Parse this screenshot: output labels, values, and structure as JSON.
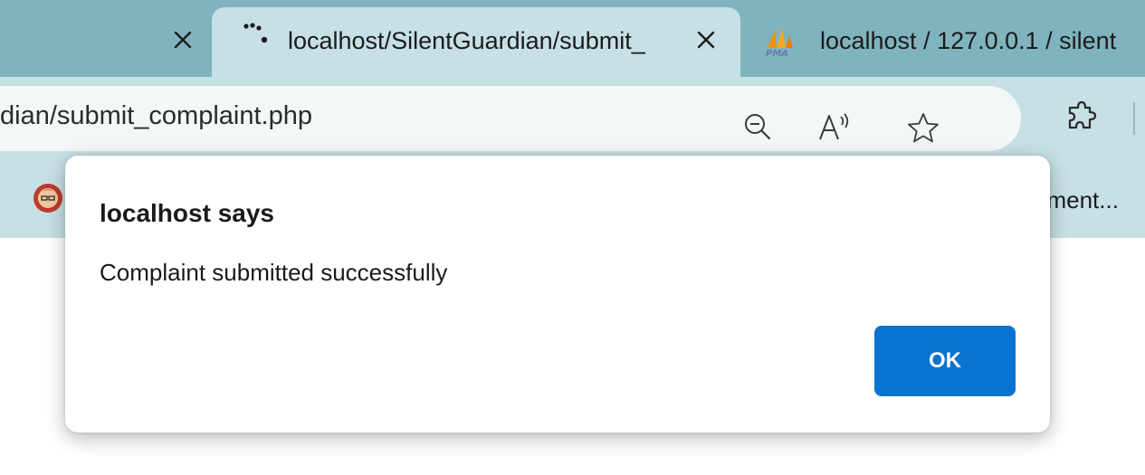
{
  "tabs": [
    {
      "title": "",
      "active": false,
      "close_label": "×"
    },
    {
      "title": "localhost/SilentGuardian/submit_",
      "active": true,
      "close_label": "×"
    },
    {
      "title": "localhost / 127.0.0.1 / silent",
      "active": false,
      "icon_text": "PMA"
    }
  ],
  "address_bar": {
    "url": "dian/submit_complaint.php"
  },
  "favorites_bar": {
    "right_item": "ement..."
  },
  "dialog": {
    "title": "localhost says",
    "message": "Complaint submitted successfully",
    "ok_label": "OK"
  },
  "colors": {
    "tabstrip": "#7fb4be",
    "toolbar": "#c7e0e5",
    "omnibox": "#f4f7f8",
    "ok_button": "#0a73d0"
  },
  "icons": [
    "close-icon",
    "loading-dots-icon",
    "pma-icon",
    "zoom-out-icon",
    "read-aloud-icon",
    "favorite-star-icon",
    "extensions-icon",
    "avatar-icon"
  ]
}
